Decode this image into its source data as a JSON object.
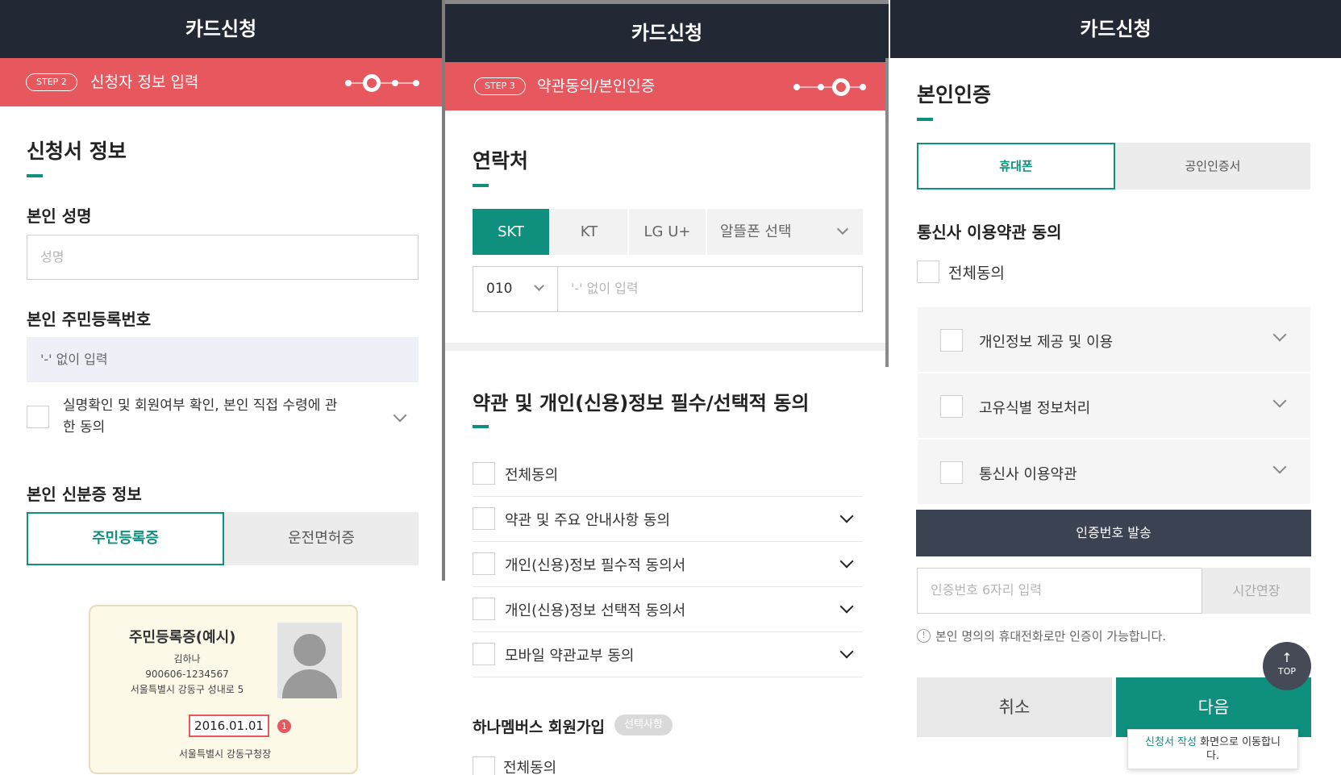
{
  "panel1": {
    "title": "카드신청",
    "step_badge": "STEP 2",
    "step_title": "신청자 정보 입력",
    "section_title": "신청서 정보",
    "name_label": "본인 성명",
    "name_placeholder": "성명",
    "rrn_label": "본인 주민등록번호",
    "rrn_placeholder": "'-' 없이 입력",
    "consent_line1": "실명확인 및 회원여부 확인, 본인 직접 수령에 관",
    "consent_line2": "한 동의",
    "id_label": "본인 신분증 정보",
    "tabs": [
      "주민등록증",
      "운전면허증"
    ],
    "card": {
      "title": "주민등록증(예시)",
      "name": "김하나",
      "number": "900606-1234567",
      "address": "서울특별시 강동구 성내로 5",
      "date": "2016.01.01",
      "badge": "1",
      "issuer": "서울특별시 강동구청장"
    }
  },
  "panel2": {
    "title": "카드신청",
    "step_badge": "STEP 3",
    "step_title": "약관동의/본인인증",
    "contact_title": "연락처",
    "carriers": [
      "SKT",
      "KT",
      "LG U+",
      "알뜰폰 선택"
    ],
    "phone_prefix": "010",
    "phone_placeholder": "'-' 없이 입력",
    "terms_title": "약관 및 개인(신용)정보 필수/선택적 동의",
    "agree_all": "전체동의",
    "terms": [
      "약관 및 주요 안내사항 동의",
      "개인(신용)정보 필수적 동의서",
      "개인(신용)정보 선택적 동의서",
      "모바일 약관교부 동의"
    ],
    "membership_title": "하나멤버스 회원가입",
    "membership_badge": "선택사항",
    "membership_agree_all": "전체동의"
  },
  "panel3": {
    "title": "카드신청",
    "section_title": "본인인증",
    "tabs": [
      "휴대폰",
      "공인인증서"
    ],
    "carrier_terms_title": "통신사 이용약관 동의",
    "agree_all": "전체동의",
    "terms": [
      "개인정보 제공 및 이용",
      "고유식별 정보처리",
      "통신사 이용약관"
    ],
    "send_code": "인증번호 발송",
    "code_placeholder": "인증번호 6자리 입력",
    "extend_time": "시간연장",
    "notice": "본인 명의의 휴대전화로만 인증이 가능합니다.",
    "top_label": "TOP",
    "cancel": "취소",
    "next": "다음",
    "tooltip_highlight": "신청서 작성",
    "tooltip_rest": " 화면으로 이동합니",
    "tooltip_line2": "다."
  },
  "colors": {
    "header": "#232835",
    "step": "#e6575e",
    "accent": "#0f8f7d"
  }
}
